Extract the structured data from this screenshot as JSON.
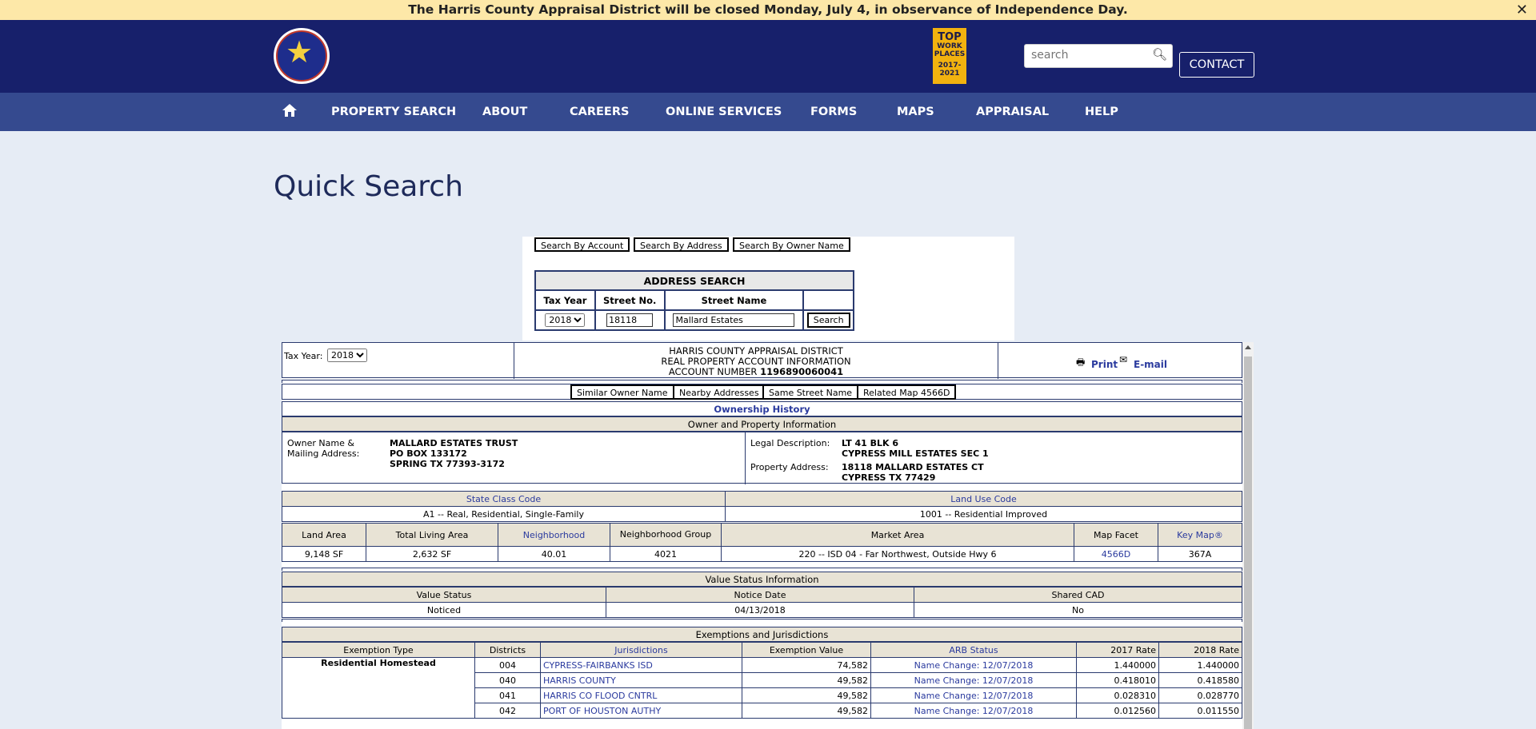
{
  "alert": {
    "text": "The Harris County Appraisal District will be closed Monday, July 4, in observance of Independence Day.",
    "close": "✕"
  },
  "header": {
    "badge": {
      "line1": "TOP",
      "line2": "WORK",
      "line3": "PLACES",
      "line4": "2017-2021"
    },
    "search_placeholder": "search",
    "contact": "CONTACT"
  },
  "nav": {
    "items": [
      "PROPERTY SEARCH",
      "ABOUT",
      "CAREERS",
      "ONLINE SERVICES",
      "FORMS",
      "MAPS",
      "APPRAISAL",
      "HELP"
    ]
  },
  "page_title": "Quick Search",
  "search_tabs": [
    "Search By Account",
    "Search By Address",
    "Search By Owner Name"
  ],
  "address_search": {
    "title": "ADDRESS SEARCH",
    "headers": [
      "Tax Year",
      "Street No.",
      "Street Name"
    ],
    "tax_year": "2018",
    "street_no": "18118",
    "street_name": "Mallard Estates",
    "button": "Search"
  },
  "account": {
    "tax_year_label": "Tax Year:",
    "tax_year": "2018",
    "line1": "HARRIS COUNTY APPRAISAL DISTRICT",
    "line2": "REAL PROPERTY ACCOUNT INFORMATION",
    "acct_label": "ACCOUNT NUMBER",
    "acct_number": "1196890060041",
    "print": "Print",
    "email": "E-mail"
  },
  "related_buttons": [
    "Similar Owner Name",
    "Nearby Addresses",
    "Same Street Name",
    "Related Map 4566D"
  ],
  "ownership_history": "Ownership History",
  "owner_section": {
    "title": "Owner and Property Information",
    "owner_label_1": "Owner Name &",
    "owner_label_2": "Mailing Address:",
    "owner_lines": [
      "MALLARD ESTATES TRUST",
      "PO BOX 133172",
      "SPRING TX 77393-3172"
    ],
    "legal_label": "Legal Description:",
    "legal_lines": [
      "LT 41 BLK 6",
      "CYPRESS MILL ESTATES SEC 1"
    ],
    "prop_label": "Property Address:",
    "prop_lines": [
      "18118 MALLARD ESTATES CT",
      "CYPRESS TX 77429"
    ]
  },
  "class_codes": {
    "state_class_header": "State Class Code",
    "land_use_header": "Land Use Code",
    "state_class": "A1 -- Real, Residential, Single-Family",
    "land_use": "1001 -- Residential Improved"
  },
  "land": {
    "headers": [
      "Land Area",
      "Total Living Area",
      "Neighborhood",
      "Neighborhood Group",
      "Market Area",
      "Map Facet",
      "Key Map®"
    ],
    "values": [
      "9,148 SF",
      "2,632 SF",
      "40.01",
      "4021",
      "220 -- ISD 04 - Far Northwest, Outside Hwy 6",
      "4566D",
      "367A"
    ]
  },
  "value_status": {
    "title": "Value Status Information",
    "headers": [
      "Value Status",
      "Notice Date",
      "Shared CAD"
    ],
    "values": [
      "Noticed",
      "04/13/2018",
      "No"
    ]
  },
  "exemptions": {
    "title": "Exemptions and Jurisdictions",
    "headers": [
      "Exemption Type",
      "Districts",
      "Jurisdictions",
      "Exemption Value",
      "ARB Status",
      "2017 Rate",
      "2018 Rate"
    ],
    "exemption_type": "Residential Homestead",
    "rows": [
      {
        "district": "004",
        "jurisdiction": "CYPRESS-FAIRBANKS ISD",
        "value": "74,582",
        "arb": "Name Change: 12/07/2018",
        "r2017": "1.440000",
        "r2018": "1.440000"
      },
      {
        "district": "040",
        "jurisdiction": "HARRIS COUNTY",
        "value": "49,582",
        "arb": "Name Change: 12/07/2018",
        "r2017": "0.418010",
        "r2018": "0.418580"
      },
      {
        "district": "041",
        "jurisdiction": "HARRIS CO FLOOD CNTRL",
        "value": "49,582",
        "arb": "Name Change: 12/07/2018",
        "r2017": "0.028310",
        "r2018": "0.028770"
      },
      {
        "district": "042",
        "jurisdiction": "PORT OF HOUSTON AUTHY",
        "value": "49,582",
        "arb": "Name Change: 12/07/2018",
        "r2017": "0.012560",
        "r2018": "0.011550"
      }
    ]
  }
}
